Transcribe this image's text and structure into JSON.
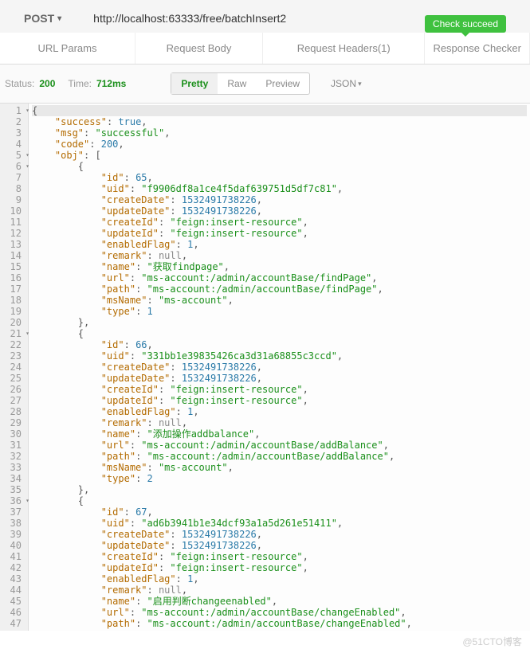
{
  "method": "POST",
  "url": "http://localhost:63333/free/batchInsert2",
  "tabs": [
    "URL Params",
    "Request Body",
    "Request Headers(1)",
    "Response Checker"
  ],
  "badge": "Check succeed",
  "status_label": "Status:",
  "status_value": "200",
  "time_label": "Time:",
  "time_value": "712ms",
  "view_modes": [
    "Pretty",
    "Raw",
    "Preview"
  ],
  "format": "JSON",
  "watermark": "@51CTO博客",
  "code_lines": [
    {
      "n": 1,
      "fold": true,
      "indent": 0,
      "hl": true,
      "tokens": [
        {
          "t": "p",
          "v": "{"
        }
      ]
    },
    {
      "n": 2,
      "indent": 1,
      "tokens": [
        {
          "t": "k",
          "v": "\"success\""
        },
        {
          "t": "p",
          "v": ": "
        },
        {
          "t": "b",
          "v": "true"
        },
        {
          "t": "p",
          "v": ","
        }
      ]
    },
    {
      "n": 3,
      "indent": 1,
      "tokens": [
        {
          "t": "k",
          "v": "\"msg\""
        },
        {
          "t": "p",
          "v": ": "
        },
        {
          "t": "s",
          "v": "\"successful\""
        },
        {
          "t": "p",
          "v": ","
        }
      ]
    },
    {
      "n": 4,
      "indent": 1,
      "tokens": [
        {
          "t": "k",
          "v": "\"code\""
        },
        {
          "t": "p",
          "v": ": "
        },
        {
          "t": "n",
          "v": "200"
        },
        {
          "t": "p",
          "v": ","
        }
      ]
    },
    {
      "n": 5,
      "fold": true,
      "indent": 1,
      "tokens": [
        {
          "t": "k",
          "v": "\"obj\""
        },
        {
          "t": "p",
          "v": ": ["
        }
      ]
    },
    {
      "n": 6,
      "fold": true,
      "indent": 2,
      "tokens": [
        {
          "t": "p",
          "v": "{"
        }
      ]
    },
    {
      "n": 7,
      "indent": 3,
      "tokens": [
        {
          "t": "k",
          "v": "\"id\""
        },
        {
          "t": "p",
          "v": ": "
        },
        {
          "t": "n",
          "v": "65"
        },
        {
          "t": "p",
          "v": ","
        }
      ]
    },
    {
      "n": 8,
      "indent": 3,
      "tokens": [
        {
          "t": "k",
          "v": "\"uid\""
        },
        {
          "t": "p",
          "v": ": "
        },
        {
          "t": "s",
          "v": "\"f9906df8a1ce4f5daf639751d5df7c81\""
        },
        {
          "t": "p",
          "v": ","
        }
      ]
    },
    {
      "n": 9,
      "indent": 3,
      "tokens": [
        {
          "t": "k",
          "v": "\"createDate\""
        },
        {
          "t": "p",
          "v": ": "
        },
        {
          "t": "n",
          "v": "1532491738226"
        },
        {
          "t": "p",
          "v": ","
        }
      ]
    },
    {
      "n": 10,
      "indent": 3,
      "tokens": [
        {
          "t": "k",
          "v": "\"updateDate\""
        },
        {
          "t": "p",
          "v": ": "
        },
        {
          "t": "n",
          "v": "1532491738226"
        },
        {
          "t": "p",
          "v": ","
        }
      ]
    },
    {
      "n": 11,
      "indent": 3,
      "tokens": [
        {
          "t": "k",
          "v": "\"createId\""
        },
        {
          "t": "p",
          "v": ": "
        },
        {
          "t": "s",
          "v": "\"feign:insert-resource\""
        },
        {
          "t": "p",
          "v": ","
        }
      ]
    },
    {
      "n": 12,
      "indent": 3,
      "tokens": [
        {
          "t": "k",
          "v": "\"updateId\""
        },
        {
          "t": "p",
          "v": ": "
        },
        {
          "t": "s",
          "v": "\"feign:insert-resource\""
        },
        {
          "t": "p",
          "v": ","
        }
      ]
    },
    {
      "n": 13,
      "indent": 3,
      "tokens": [
        {
          "t": "k",
          "v": "\"enabledFlag\""
        },
        {
          "t": "p",
          "v": ": "
        },
        {
          "t": "n",
          "v": "1"
        },
        {
          "t": "p",
          "v": ","
        }
      ]
    },
    {
      "n": 14,
      "indent": 3,
      "tokens": [
        {
          "t": "k",
          "v": "\"remark\""
        },
        {
          "t": "p",
          "v": ": "
        },
        {
          "t": "nl",
          "v": "null"
        },
        {
          "t": "p",
          "v": ","
        }
      ]
    },
    {
      "n": 15,
      "indent": 3,
      "tokens": [
        {
          "t": "k",
          "v": "\"name\""
        },
        {
          "t": "p",
          "v": ": "
        },
        {
          "t": "s",
          "v": "\"获取findpage\""
        },
        {
          "t": "p",
          "v": ","
        }
      ]
    },
    {
      "n": 16,
      "indent": 3,
      "tokens": [
        {
          "t": "k",
          "v": "\"url\""
        },
        {
          "t": "p",
          "v": ": "
        },
        {
          "t": "s",
          "v": "\"ms-account:/admin/accountBase/findPage\""
        },
        {
          "t": "p",
          "v": ","
        }
      ]
    },
    {
      "n": 17,
      "indent": 3,
      "tokens": [
        {
          "t": "k",
          "v": "\"path\""
        },
        {
          "t": "p",
          "v": ": "
        },
        {
          "t": "s",
          "v": "\"ms-account:/admin/accountBase/findPage\""
        },
        {
          "t": "p",
          "v": ","
        }
      ]
    },
    {
      "n": 18,
      "indent": 3,
      "tokens": [
        {
          "t": "k",
          "v": "\"msName\""
        },
        {
          "t": "p",
          "v": ": "
        },
        {
          "t": "s",
          "v": "\"ms-account\""
        },
        {
          "t": "p",
          "v": ","
        }
      ]
    },
    {
      "n": 19,
      "indent": 3,
      "tokens": [
        {
          "t": "k",
          "v": "\"type\""
        },
        {
          "t": "p",
          "v": ": "
        },
        {
          "t": "n",
          "v": "1"
        }
      ]
    },
    {
      "n": 20,
      "indent": 2,
      "tokens": [
        {
          "t": "p",
          "v": "},"
        }
      ]
    },
    {
      "n": 21,
      "fold": true,
      "indent": 2,
      "tokens": [
        {
          "t": "p",
          "v": "{"
        }
      ]
    },
    {
      "n": 22,
      "indent": 3,
      "tokens": [
        {
          "t": "k",
          "v": "\"id\""
        },
        {
          "t": "p",
          "v": ": "
        },
        {
          "t": "n",
          "v": "66"
        },
        {
          "t": "p",
          "v": ","
        }
      ]
    },
    {
      "n": 23,
      "indent": 3,
      "tokens": [
        {
          "t": "k",
          "v": "\"uid\""
        },
        {
          "t": "p",
          "v": ": "
        },
        {
          "t": "s",
          "v": "\"331bb1e39835426ca3d31a68855c3ccd\""
        },
        {
          "t": "p",
          "v": ","
        }
      ]
    },
    {
      "n": 24,
      "indent": 3,
      "tokens": [
        {
          "t": "k",
          "v": "\"createDate\""
        },
        {
          "t": "p",
          "v": ": "
        },
        {
          "t": "n",
          "v": "1532491738226"
        },
        {
          "t": "p",
          "v": ","
        }
      ]
    },
    {
      "n": 25,
      "indent": 3,
      "tokens": [
        {
          "t": "k",
          "v": "\"updateDate\""
        },
        {
          "t": "p",
          "v": ": "
        },
        {
          "t": "n",
          "v": "1532491738226"
        },
        {
          "t": "p",
          "v": ","
        }
      ]
    },
    {
      "n": 26,
      "indent": 3,
      "tokens": [
        {
          "t": "k",
          "v": "\"createId\""
        },
        {
          "t": "p",
          "v": ": "
        },
        {
          "t": "s",
          "v": "\"feign:insert-resource\""
        },
        {
          "t": "p",
          "v": ","
        }
      ]
    },
    {
      "n": 27,
      "indent": 3,
      "tokens": [
        {
          "t": "k",
          "v": "\"updateId\""
        },
        {
          "t": "p",
          "v": ": "
        },
        {
          "t": "s",
          "v": "\"feign:insert-resource\""
        },
        {
          "t": "p",
          "v": ","
        }
      ]
    },
    {
      "n": 28,
      "indent": 3,
      "tokens": [
        {
          "t": "k",
          "v": "\"enabledFlag\""
        },
        {
          "t": "p",
          "v": ": "
        },
        {
          "t": "n",
          "v": "1"
        },
        {
          "t": "p",
          "v": ","
        }
      ]
    },
    {
      "n": 29,
      "indent": 3,
      "tokens": [
        {
          "t": "k",
          "v": "\"remark\""
        },
        {
          "t": "p",
          "v": ": "
        },
        {
          "t": "nl",
          "v": "null"
        },
        {
          "t": "p",
          "v": ","
        }
      ]
    },
    {
      "n": 30,
      "indent": 3,
      "tokens": [
        {
          "t": "k",
          "v": "\"name\""
        },
        {
          "t": "p",
          "v": ": "
        },
        {
          "t": "s",
          "v": "\"添加操作addbalance\""
        },
        {
          "t": "p",
          "v": ","
        }
      ]
    },
    {
      "n": 31,
      "indent": 3,
      "tokens": [
        {
          "t": "k",
          "v": "\"url\""
        },
        {
          "t": "p",
          "v": ": "
        },
        {
          "t": "s",
          "v": "\"ms-account:/admin/accountBase/addBalance\""
        },
        {
          "t": "p",
          "v": ","
        }
      ]
    },
    {
      "n": 32,
      "indent": 3,
      "tokens": [
        {
          "t": "k",
          "v": "\"path\""
        },
        {
          "t": "p",
          "v": ": "
        },
        {
          "t": "s",
          "v": "\"ms-account:/admin/accountBase/addBalance\""
        },
        {
          "t": "p",
          "v": ","
        }
      ]
    },
    {
      "n": 33,
      "indent": 3,
      "tokens": [
        {
          "t": "k",
          "v": "\"msName\""
        },
        {
          "t": "p",
          "v": ": "
        },
        {
          "t": "s",
          "v": "\"ms-account\""
        },
        {
          "t": "p",
          "v": ","
        }
      ]
    },
    {
      "n": 34,
      "indent": 3,
      "tokens": [
        {
          "t": "k",
          "v": "\"type\""
        },
        {
          "t": "p",
          "v": ": "
        },
        {
          "t": "n",
          "v": "2"
        }
      ]
    },
    {
      "n": 35,
      "indent": 2,
      "tokens": [
        {
          "t": "p",
          "v": "},"
        }
      ]
    },
    {
      "n": 36,
      "fold": true,
      "indent": 2,
      "tokens": [
        {
          "t": "p",
          "v": "{"
        }
      ]
    },
    {
      "n": 37,
      "indent": 3,
      "tokens": [
        {
          "t": "k",
          "v": "\"id\""
        },
        {
          "t": "p",
          "v": ": "
        },
        {
          "t": "n",
          "v": "67"
        },
        {
          "t": "p",
          "v": ","
        }
      ]
    },
    {
      "n": 38,
      "indent": 3,
      "tokens": [
        {
          "t": "k",
          "v": "\"uid\""
        },
        {
          "t": "p",
          "v": ": "
        },
        {
          "t": "s",
          "v": "\"ad6b3941b1e34dcf93a1a5d261e51411\""
        },
        {
          "t": "p",
          "v": ","
        }
      ]
    },
    {
      "n": 39,
      "indent": 3,
      "tokens": [
        {
          "t": "k",
          "v": "\"createDate\""
        },
        {
          "t": "p",
          "v": ": "
        },
        {
          "t": "n",
          "v": "1532491738226"
        },
        {
          "t": "p",
          "v": ","
        }
      ]
    },
    {
      "n": 40,
      "indent": 3,
      "tokens": [
        {
          "t": "k",
          "v": "\"updateDate\""
        },
        {
          "t": "p",
          "v": ": "
        },
        {
          "t": "n",
          "v": "1532491738226"
        },
        {
          "t": "p",
          "v": ","
        }
      ]
    },
    {
      "n": 41,
      "indent": 3,
      "tokens": [
        {
          "t": "k",
          "v": "\"createId\""
        },
        {
          "t": "p",
          "v": ": "
        },
        {
          "t": "s",
          "v": "\"feign:insert-resource\""
        },
        {
          "t": "p",
          "v": ","
        }
      ]
    },
    {
      "n": 42,
      "indent": 3,
      "tokens": [
        {
          "t": "k",
          "v": "\"updateId\""
        },
        {
          "t": "p",
          "v": ": "
        },
        {
          "t": "s",
          "v": "\"feign:insert-resource\""
        },
        {
          "t": "p",
          "v": ","
        }
      ]
    },
    {
      "n": 43,
      "indent": 3,
      "tokens": [
        {
          "t": "k",
          "v": "\"enabledFlag\""
        },
        {
          "t": "p",
          "v": ": "
        },
        {
          "t": "n",
          "v": "1"
        },
        {
          "t": "p",
          "v": ","
        }
      ]
    },
    {
      "n": 44,
      "indent": 3,
      "tokens": [
        {
          "t": "k",
          "v": "\"remark\""
        },
        {
          "t": "p",
          "v": ": "
        },
        {
          "t": "nl",
          "v": "null"
        },
        {
          "t": "p",
          "v": ","
        }
      ]
    },
    {
      "n": 45,
      "indent": 3,
      "tokens": [
        {
          "t": "k",
          "v": "\"name\""
        },
        {
          "t": "p",
          "v": ": "
        },
        {
          "t": "s",
          "v": "\"启用判断changeenabled\""
        },
        {
          "t": "p",
          "v": ","
        }
      ]
    },
    {
      "n": 46,
      "indent": 3,
      "tokens": [
        {
          "t": "k",
          "v": "\"url\""
        },
        {
          "t": "p",
          "v": ": "
        },
        {
          "t": "s",
          "v": "\"ms-account:/admin/accountBase/changeEnabled\""
        },
        {
          "t": "p",
          "v": ","
        }
      ]
    },
    {
      "n": 47,
      "indent": 3,
      "tokens": [
        {
          "t": "k",
          "v": "\"path\""
        },
        {
          "t": "p",
          "v": ": "
        },
        {
          "t": "s",
          "v": "\"ms-account:/admin/accountBase/changeEnabled\""
        },
        {
          "t": "p",
          "v": ","
        }
      ]
    }
  ]
}
